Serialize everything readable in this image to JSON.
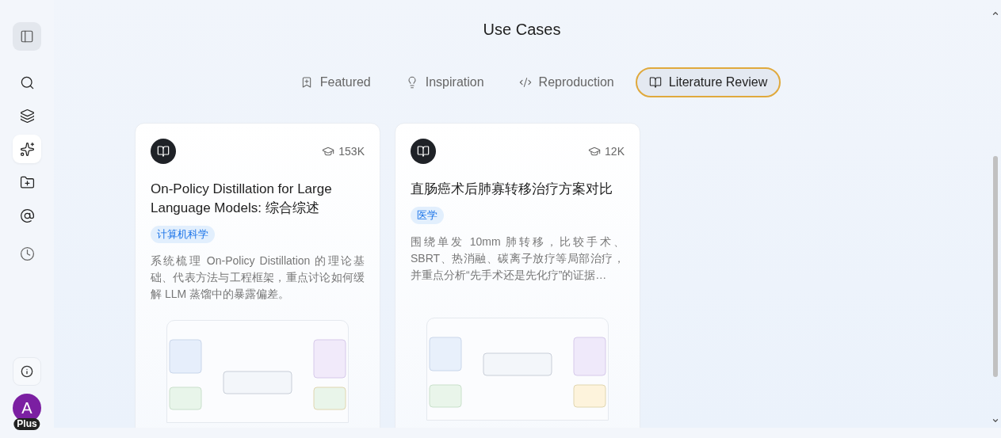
{
  "sidebar": {
    "toggle": {
      "on": true
    },
    "items": [
      {
        "selected": false
      },
      {
        "selected": false
      },
      {
        "selected": true
      },
      {
        "selected": false
      },
      {
        "selected": false
      },
      {
        "selected": false
      }
    ],
    "avatar": {
      "initial": "A",
      "badge": "Plus"
    }
  },
  "page": {
    "title": "Use Cases"
  },
  "tabs": [
    {
      "label": "Featured",
      "selected": false
    },
    {
      "label": "Inspiration",
      "selected": false
    },
    {
      "label": "Reproduction",
      "selected": false
    },
    {
      "label": "Literature Review",
      "selected": true
    }
  ],
  "cards": [
    {
      "count": "153K",
      "title": "On-Policy Distillation for Large Language Models: 综合综述",
      "tag": "计算机科学",
      "description": "系统梳理 On-Policy Distillation 的理论基础、代表方法与工程框架，重点讨论如何缓解 LLM 蒸馏中的暴露偏差。"
    },
    {
      "count": "12K",
      "title": "直肠癌术后肺寡转移治疗方案对比",
      "tag": "医学",
      "description": "围绕单发 10mm 肺转移，比较手术、SBRT、热消融、碳离子放疗等局部治疗，并重点分析“先手术还是先化疗”的证据…"
    }
  ]
}
